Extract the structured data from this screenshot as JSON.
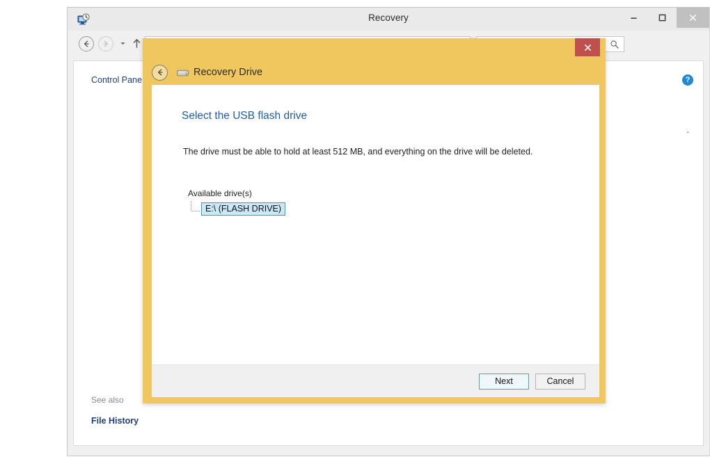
{
  "window": {
    "title": "Recovery",
    "icon": "recovery-system-restore-icon",
    "controls": {
      "minimize": "–",
      "maximize": "❑",
      "close": "✕"
    },
    "nav": {
      "back": "←",
      "forward": "→",
      "dropdown": "▾",
      "up": "↑",
      "address_icon": "control-panel-icon",
      "search_icon": "search-icon"
    },
    "content": {
      "breadcrumb": "Control Pane",
      "help_icon": "?",
      "body_text_fragment": ".",
      "see_also_label": "See also",
      "see_also_link": "File History"
    }
  },
  "dialog": {
    "title": "Recovery Drive",
    "title_icon": "drive-icon",
    "back_arrow": "←",
    "close_label": "✕",
    "heading": "Select the USB flash drive",
    "description": "The drive must be able to hold at least 512 MB, and everything on the drive will be deleted.",
    "drives_label": "Available drive(s)",
    "drives": [
      {
        "label": "E:\\ (FLASH DRIVE)",
        "selected": true
      }
    ],
    "buttons": {
      "next": "Next",
      "cancel": "Cancel"
    }
  },
  "colors": {
    "dialog_frame": "#efc75e",
    "dialog_close": "#c0504d",
    "heading_blue": "#1f5ea8",
    "selection_fill": "#cce8f4",
    "selection_border": "#26a0da",
    "link_blue": "#1f3f7a",
    "help_blue": "#1e8ad6"
  }
}
